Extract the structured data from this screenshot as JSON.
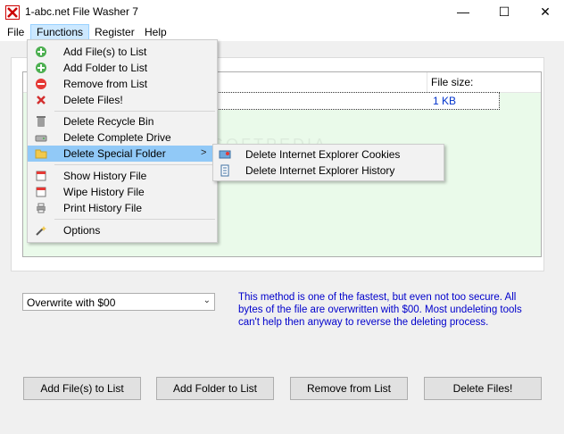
{
  "window": {
    "title": "1-abc.net File Washer 7",
    "min": "—",
    "max": "☐",
    "close": "✕"
  },
  "menubar": {
    "file": "File",
    "functions": "Functions",
    "register": "Register",
    "help": "Help"
  },
  "file_list": {
    "size_header": "File size:",
    "rows": [
      {
        "size": "1 KB"
      }
    ]
  },
  "functions_menu": {
    "add_files": "Add File(s) to List",
    "add_folder": "Add Folder to List",
    "remove": "Remove from List",
    "delete_files": "Delete Files!",
    "recycle_bin": "Delete Recycle Bin",
    "complete_drive": "Delete Complete Drive",
    "special_folder": "Delete Special Folder",
    "show_history": "Show History File",
    "wipe_history": "Wipe History File",
    "print_history": "Print History File",
    "options": "Options"
  },
  "special_submenu": {
    "ie_cookies": "Delete Internet Explorer Cookies",
    "ie_history": "Delete Internet Explorer History"
  },
  "method": {
    "selected": "Overwrite with $00",
    "description": "This method is one of the fastest, but even not too secure. All bytes of the file are overwritten with $00. Most undeleting tools can't help then anyway to reverse the deleting process."
  },
  "buttons": {
    "add_files": "Add File(s) to List",
    "add_folder": "Add Folder to List",
    "remove": "Remove from List",
    "delete": "Delete Files!"
  },
  "colors": {
    "accent": "#91c9f7",
    "list_bg": "#eafaea",
    "desc_text": "#0000cc"
  }
}
